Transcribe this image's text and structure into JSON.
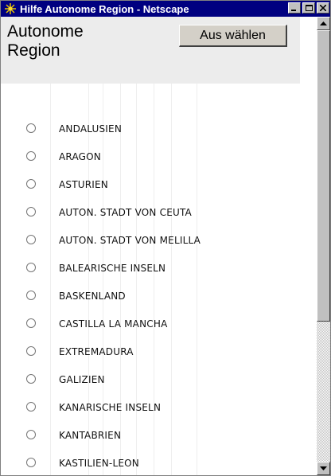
{
  "window": {
    "title": "Hilfe Autonome Region - Netscape",
    "app_icon": "netscape-icon",
    "buttons": [
      "minimize-icon",
      "maximize-icon",
      "close-icon"
    ]
  },
  "page": {
    "title": "Autonome Region",
    "select_button_label": "Aus wählen"
  },
  "regions": [
    "ANDALUSIEN",
    "ARAGON",
    "ASTURIEN",
    "AUTON. STADT VON CEUTA",
    "AUTON. STADT VON MELILLA",
    "BALEARISCHE INSELN",
    "BASKENLAND",
    "CASTILLA LA MANCHA",
    "EXTREMADURA",
    "GALIZIEN",
    "KANARISCHE INSELN",
    "KANTABRIEN",
    "KASTILIEN-LEON"
  ],
  "colors": {
    "titlebar": "#000080",
    "header_band": "#ececec",
    "button_face": "#d4d0c8"
  }
}
